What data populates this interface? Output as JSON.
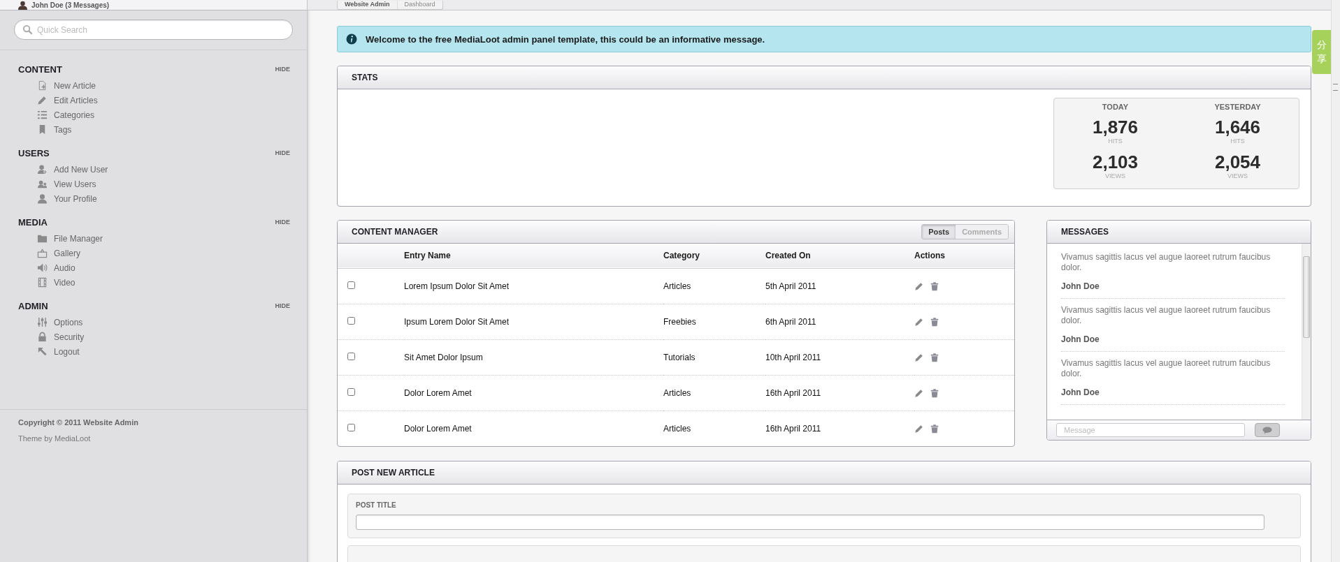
{
  "header": {
    "user": "John Doe (3 Messages)",
    "breadcrumbs": [
      {
        "label": "Website Admin",
        "selected": false
      },
      {
        "label": "Dashboard",
        "selected": true
      }
    ]
  },
  "sidebar": {
    "search": {
      "placeholder": "Quick Search"
    },
    "sections": [
      {
        "title": "CONTENT",
        "toggle": "HIDE",
        "items": [
          {
            "label": "New Article"
          },
          {
            "label": "Edit Articles"
          },
          {
            "label": "Categories"
          },
          {
            "label": "Tags"
          }
        ]
      },
      {
        "title": "USERS",
        "toggle": "HIDE",
        "items": [
          {
            "label": "Add New User"
          },
          {
            "label": "View Users"
          },
          {
            "label": "Your Profile"
          }
        ]
      },
      {
        "title": "MEDIA",
        "toggle": "HIDE",
        "items": [
          {
            "label": "File Manager"
          },
          {
            "label": "Gallery"
          },
          {
            "label": "Audio"
          },
          {
            "label": "Video"
          }
        ]
      },
      {
        "title": "ADMIN",
        "toggle": "HIDE",
        "items": [
          {
            "label": "Options"
          },
          {
            "label": "Security"
          },
          {
            "label": "Logout"
          }
        ]
      }
    ],
    "footer": {
      "copyright": "Copyright © 2011 Website Admin",
      "credit": "Theme by MediaLoot"
    }
  },
  "alert": {
    "text": "Welcome to the free MediaLoot admin panel template, this could be an informative message."
  },
  "stats": {
    "title": "STATS",
    "columns": [
      {
        "heading": "TODAY",
        "figures": [
          {
            "value": "1,876",
            "label": "HITS"
          },
          {
            "value": "2,103",
            "label": "VIEWS"
          }
        ]
      },
      {
        "heading": "YESTERDAY",
        "figures": [
          {
            "value": "1,646",
            "label": "HITS"
          },
          {
            "value": "2,054",
            "label": "VIEWS"
          }
        ]
      }
    ]
  },
  "content_manager": {
    "title": "CONTENT MANAGER",
    "tabs": [
      {
        "label": "Posts",
        "selected": true
      },
      {
        "label": "Comments",
        "selected": false
      }
    ],
    "columns": [
      "Entry Name",
      "Category",
      "Created On",
      "Actions"
    ],
    "rows": [
      {
        "checked": false,
        "entry": "Lorem Ipsum Dolor Sit Amet",
        "category": "Articles",
        "created": "5th April 2011"
      },
      {
        "checked": false,
        "entry": "Ipsum Lorem Dolor Sit Amet",
        "category": "Freebies",
        "created": "6th April 2011"
      },
      {
        "checked": false,
        "entry": "Sit Amet Dolor Ipsum",
        "category": "Tutorials",
        "created": "10th April 2011"
      },
      {
        "checked": false,
        "entry": "Dolor Lorem Amet",
        "category": "Articles",
        "created": "16th April 2011"
      },
      {
        "checked": false,
        "entry": "Dolor Lorem Amet",
        "category": "Articles",
        "created": "16th April 2011"
      }
    ]
  },
  "messages": {
    "title": "MESSAGES",
    "items": [
      {
        "text": "Vivamus sagittis lacus vel augue laoreet rutrum faucibus dolor.",
        "author": "John Doe"
      },
      {
        "text": "Vivamus sagittis lacus vel augue laoreet rutrum faucibus dolor.",
        "author": "John Doe"
      },
      {
        "text": "Vivamus sagittis lacus vel augue laoreet rutrum faucibus dolor.",
        "author": "John Doe"
      }
    ],
    "input": {
      "placeholder": "Message"
    }
  },
  "post_article": {
    "title": "POST NEW ARTICLE",
    "fields": [
      {
        "label": "POST TITLE"
      }
    ]
  },
  "share_tab": {
    "label": "分享"
  }
}
